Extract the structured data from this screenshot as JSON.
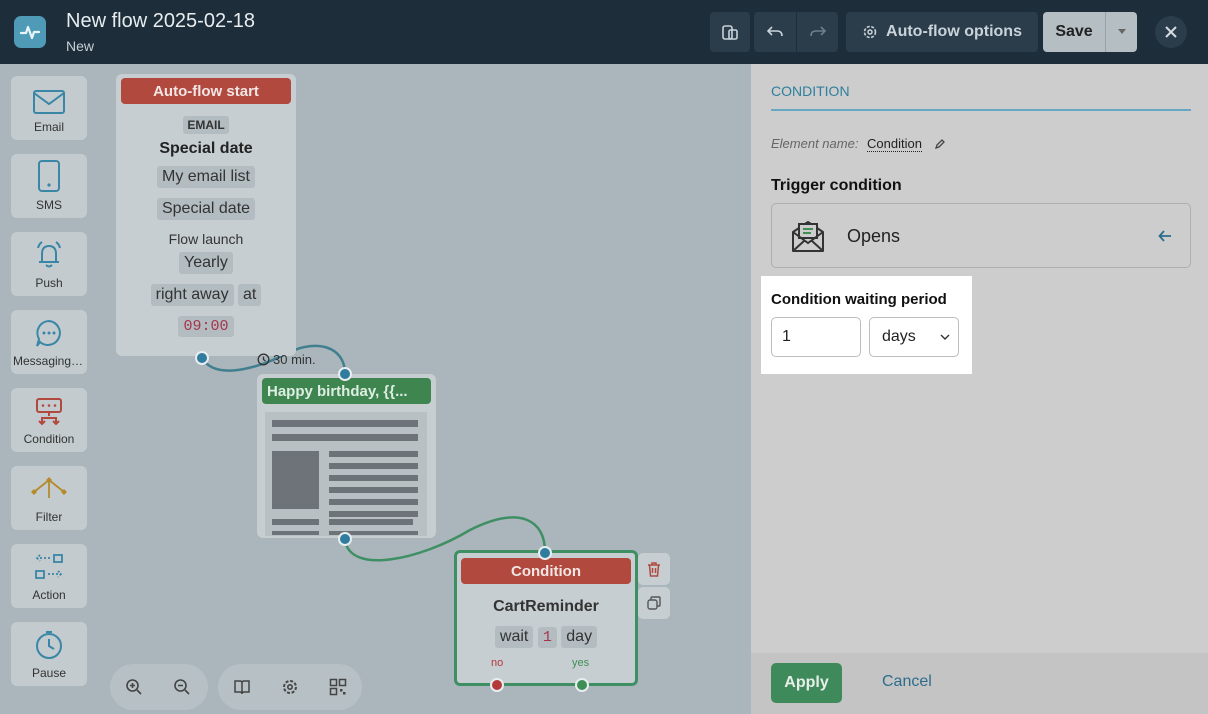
{
  "header": {
    "title": "New flow 2025-02-18",
    "subtitle": "New",
    "options_label": "Auto-flow options",
    "save_label": "Save"
  },
  "palette": [
    {
      "label": "Email",
      "icon": "email-icon"
    },
    {
      "label": "SMS",
      "icon": "phone-icon"
    },
    {
      "label": "Push",
      "icon": "bell-icon"
    },
    {
      "label": "Messaging apps",
      "icon": "chat-icon"
    },
    {
      "label": "Condition",
      "icon": "condition-icon"
    },
    {
      "label": "Filter",
      "icon": "filter-icon"
    },
    {
      "label": "Action",
      "icon": "action-icon"
    },
    {
      "label": "Pause",
      "icon": "clock-icon"
    }
  ],
  "start_node": {
    "header": "Auto-flow start",
    "channel": "EMAIL",
    "trigger": "Special date",
    "list": "My email list",
    "field": "Special date",
    "launch_label": "Flow launch",
    "frequency": "Yearly",
    "timing": "right away",
    "at_label": "at",
    "time": "09:00"
  },
  "delay_label": "30 min.",
  "email_node": {
    "header": "Happy birthday, {{..."
  },
  "condition_node": {
    "header": "Condition",
    "name": "CartReminder",
    "wait_label": "wait",
    "wait_value": "1",
    "wait_unit": "day",
    "no_label": "no",
    "yes_label": "yes"
  },
  "panel": {
    "tab": "CONDITION",
    "element_name_label": "Element name:",
    "element_name_value": "Condition",
    "trigger_label": "Trigger condition",
    "trigger_value": "Opens",
    "waiting_label": "Condition waiting period",
    "waiting_value": "1",
    "waiting_unit": "days",
    "apply_label": "Apply",
    "cancel_label": "Cancel"
  },
  "colors": {
    "header_bg": "#1d2d3a",
    "start_red": "#b1493f",
    "email_green": "#3f8550",
    "apply_green": "#3f8a5b",
    "accent_blue": "#2d7f9e"
  }
}
